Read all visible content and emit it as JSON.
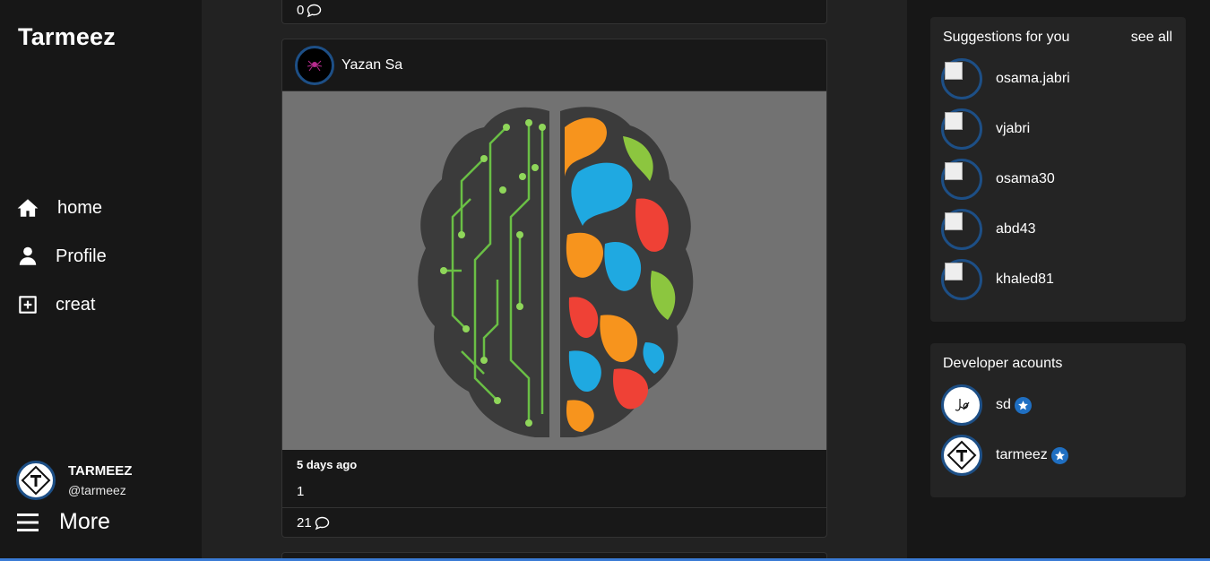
{
  "app": {
    "brand": "Tarmeez"
  },
  "nav": {
    "items": [
      {
        "label": "home",
        "icon": "home-icon"
      },
      {
        "label": "Profile",
        "icon": "user-icon"
      },
      {
        "label": "creat",
        "icon": "plus-square-icon"
      }
    ],
    "more_label": "More"
  },
  "current_user": {
    "name": "TARMEEZ",
    "handle": "@tarmeez"
  },
  "feed": {
    "previous_post": {
      "comments": "0"
    },
    "post": {
      "author": "Yazan Sa",
      "image_desc_icon": "brain-illustration",
      "date": "5 days ago",
      "body": "1",
      "comments": "21"
    }
  },
  "suggestions": {
    "title": "Suggestions for you",
    "see_all": "see all",
    "people": [
      "osama.jabri",
      "vjabri",
      "osama30",
      "abd43",
      "khaled81"
    ]
  },
  "developers": {
    "title": "Developer acounts",
    "people": [
      "sd",
      "tarmeez"
    ]
  },
  "colors": {
    "accent": "#1f6fc2",
    "avatar_ring": "#1d4f86",
    "image_bg": "#727272"
  }
}
